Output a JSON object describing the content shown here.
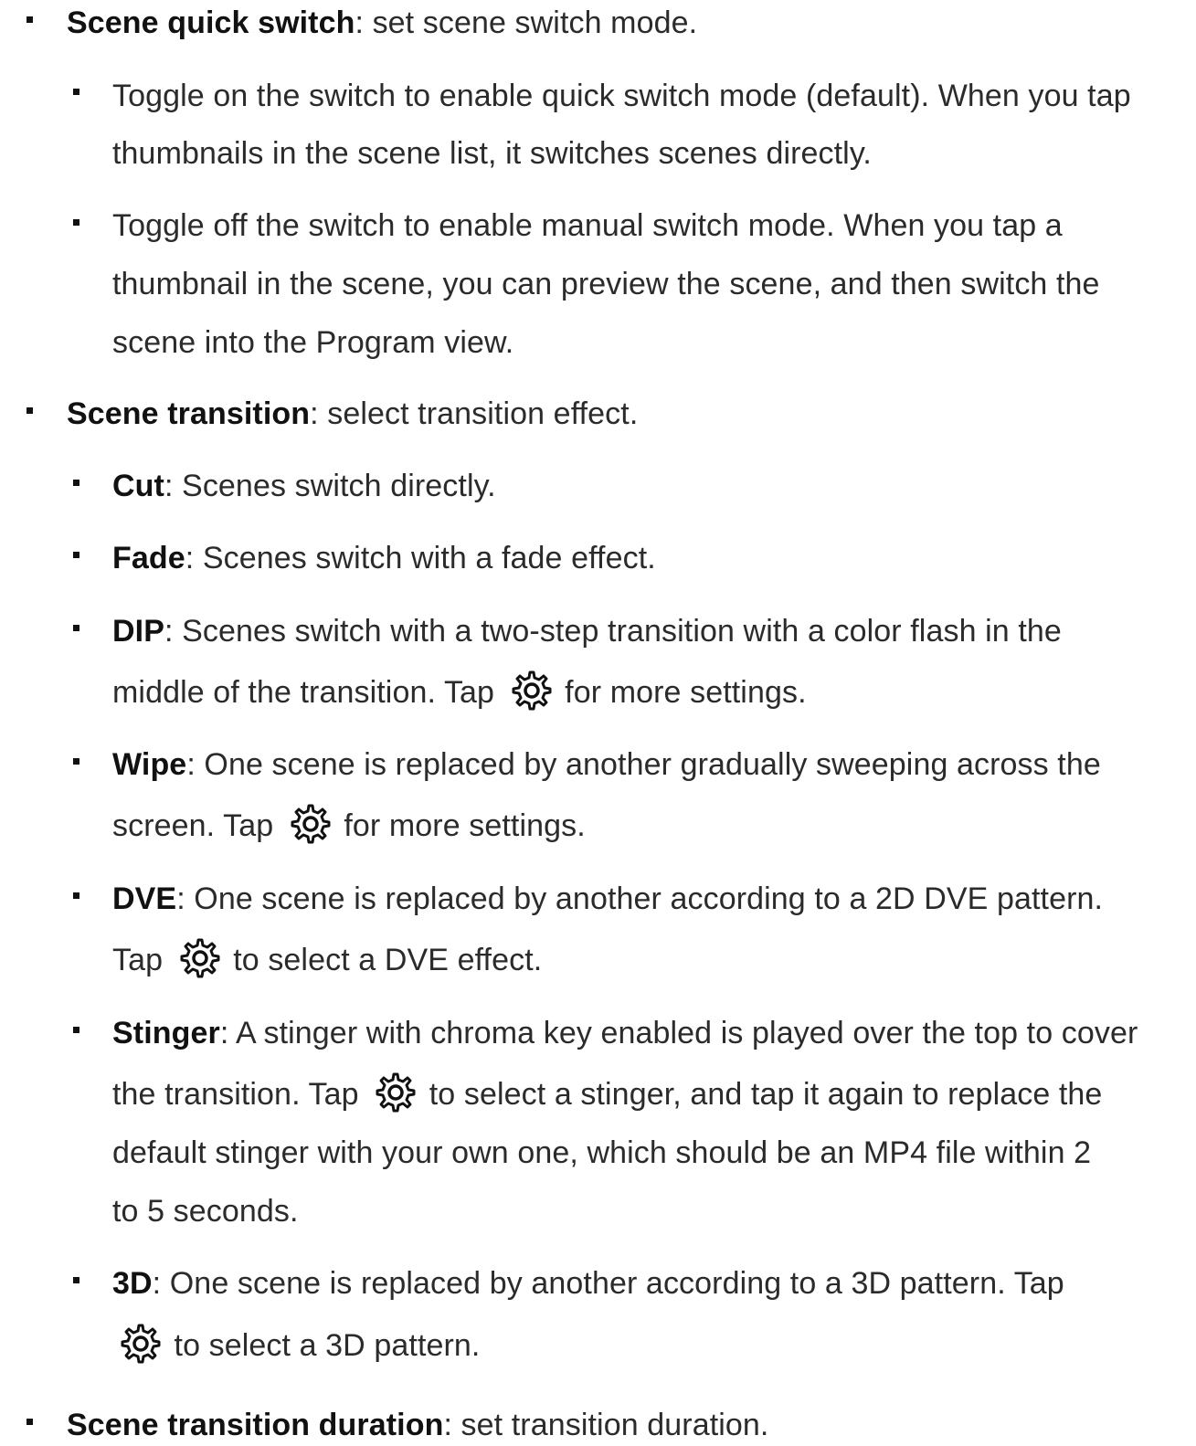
{
  "items": {
    "quick_switch": {
      "term": "Scene quick switch",
      "desc": ": set scene switch mode.",
      "sub": {
        "on": {
          "line1": "Toggle on the switch to enable quick switch mode (default). When you tap",
          "line2": "thumbnails in the scene list, it switches scenes directly."
        },
        "off": {
          "line1": "Toggle off the switch to enable manual switch mode. When you tap a",
          "line2": "thumbnail in the scene, you can preview the scene, and then switch the",
          "line3": "scene into the Program view."
        }
      }
    },
    "transition": {
      "term": "Scene transition",
      "desc": ": select transition effect.",
      "cut": {
        "term": "Cut",
        "desc": ": Scenes switch directly."
      },
      "fade": {
        "term": "Fade",
        "desc": ": Scenes switch with a fade effect."
      },
      "dip": {
        "term": "DIP",
        "desc": ": Scenes switch with a two-step transition with a color flash in the",
        "line2_a": "middle of the transition. Tap",
        "line2_b": "for more settings."
      },
      "wipe": {
        "term": "Wipe",
        "desc": ": One scene is replaced by another gradually sweeping across the",
        "line2_a": "screen. Tap",
        "line2_b": "for more settings."
      },
      "dve": {
        "term": "DVE",
        "desc": ": One scene is replaced by another according to a 2D DVE pattern.",
        "line2_a": "Tap",
        "line2_b": "to select a DVE effect."
      },
      "stinger": {
        "term": "Stinger",
        "desc": ": A stinger with chroma key enabled is played over the top to cover",
        "line2_a": "the transition. Tap",
        "line2_b": "to select a stinger, and tap it again to replace the",
        "line3": "default stinger with your own one, which should be an MP4 file within 2",
        "line4": "to 5 seconds."
      },
      "three_d": {
        "term": "3D",
        "desc": ": One scene is replaced by another according to a 3D pattern. Tap",
        "line2_b": "to select a 3D pattern."
      }
    },
    "duration": {
      "term": "Scene transition duration",
      "desc": ": set transition duration."
    }
  },
  "icons": {
    "settings": "gear-icon"
  }
}
